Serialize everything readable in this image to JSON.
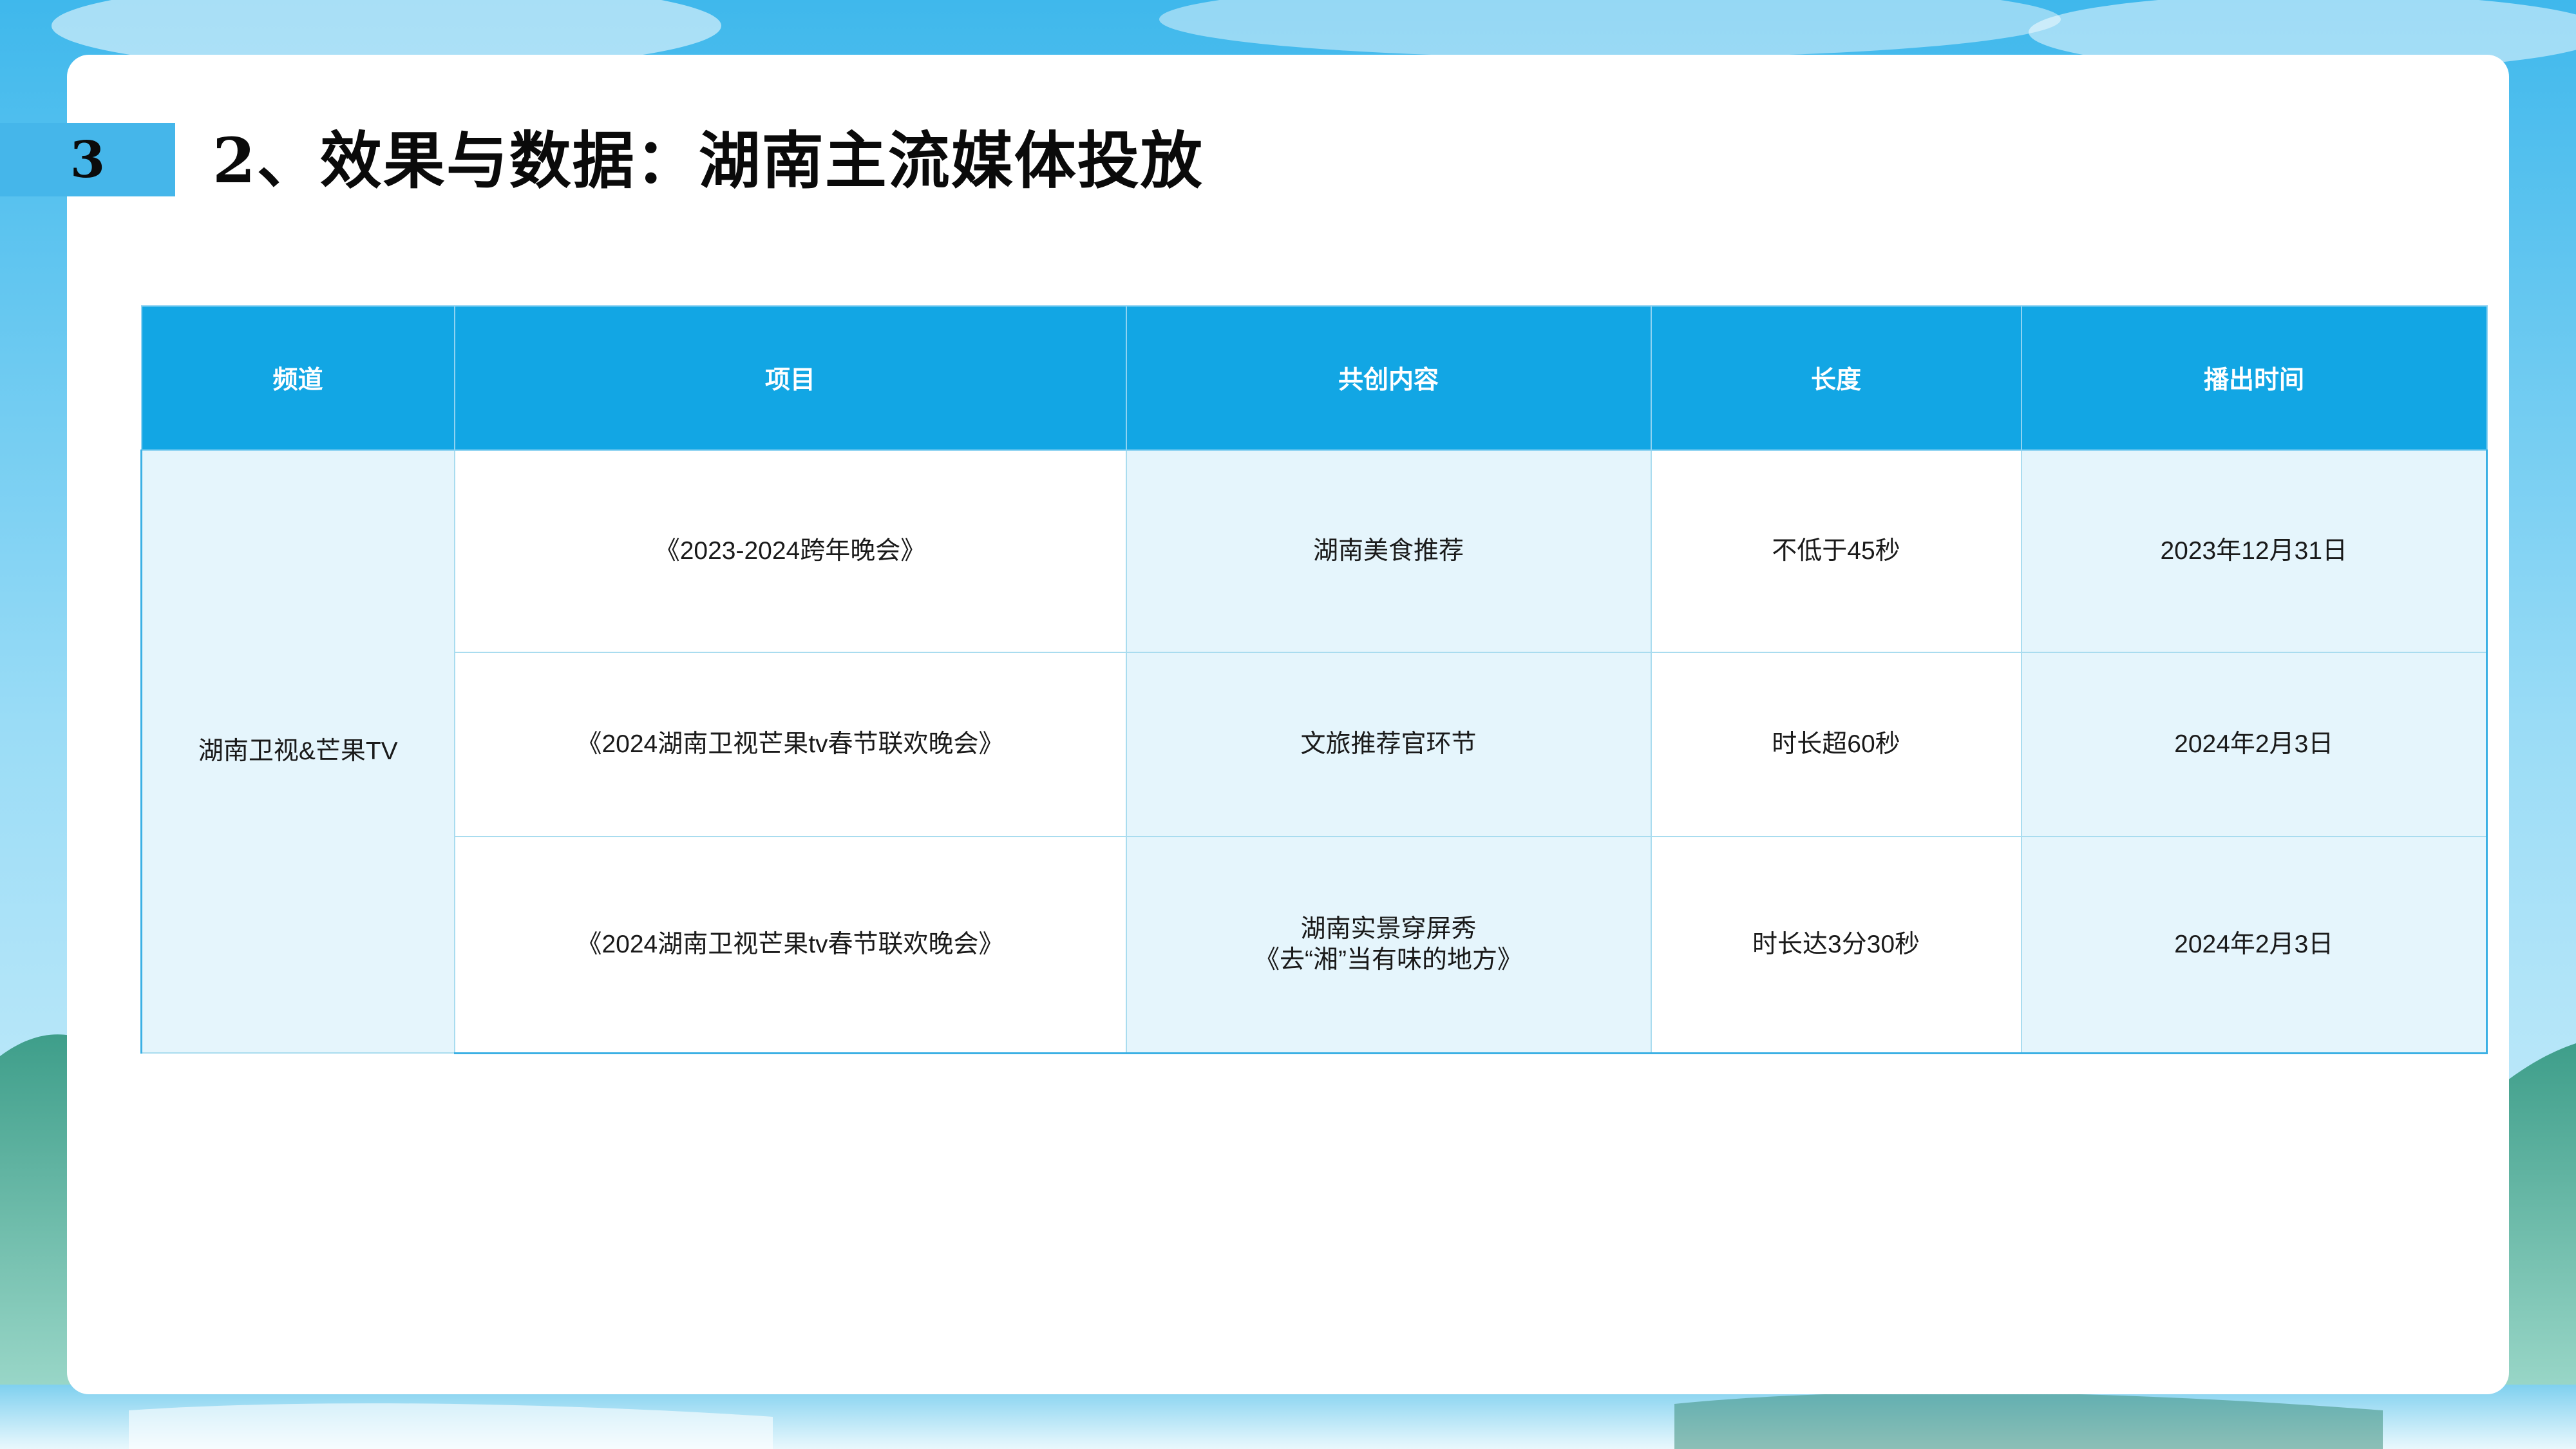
{
  "slide": {
    "number": "3",
    "title": "2、效果与数据：湖南主流媒体投放"
  },
  "table": {
    "headers": [
      "频道",
      "项目",
      "共创内容",
      "长度",
      "播出时间"
    ],
    "channel": "湖南卫视&芒果TV",
    "rows": [
      {
        "project": "《2023-2024跨年晚会》",
        "content": [
          "湖南美食推荐"
        ],
        "length": "不低于45秒",
        "air_date": "2023年12月31日"
      },
      {
        "project": "《2024湖南卫视芒果tv春节联欢晚会》",
        "content": [
          "文旅推荐官环节"
        ],
        "length": "时长超60秒",
        "air_date": "2024年2月3日"
      },
      {
        "project": "《2024湖南卫视芒果tv春节联欢晚会》",
        "content": [
          "湖南实景穿屏秀",
          "《去“湘”当有味的地方》"
        ],
        "length": "时长达3分30秒",
        "air_date": "2024年2月3日"
      }
    ]
  }
}
